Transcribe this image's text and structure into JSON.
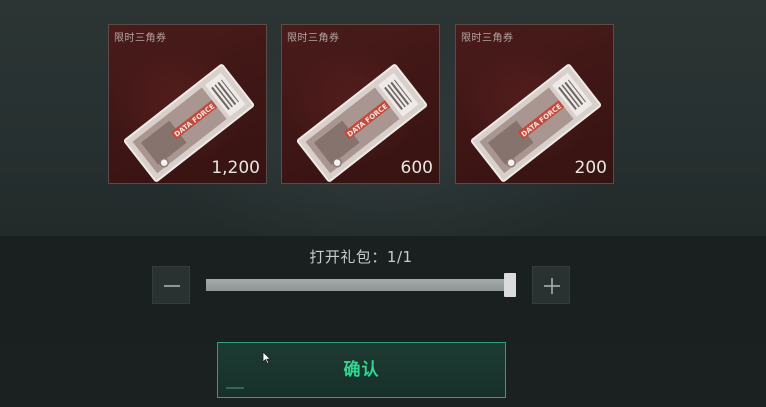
{
  "rewards": [
    {
      "tag": "限时三角券",
      "quantity": "1,200",
      "ticket_text": "DATA FORCE"
    },
    {
      "tag": "限时三角券",
      "quantity": "600",
      "ticket_text": "DATA FORCE"
    },
    {
      "tag": "限时三角券",
      "quantity": "200",
      "ticket_text": "DATA FORCE"
    }
  ],
  "stepper": {
    "label": "打开礼包：1/1",
    "current": 1,
    "max": 1,
    "fill_fraction": 1.0,
    "minus_icon": "minus-icon",
    "plus_icon": "plus-icon"
  },
  "confirm": {
    "label": "确认"
  },
  "colors": {
    "accent": "#34d48f",
    "card_bg": "#451a19",
    "slider_fill": "#9ca2a2"
  }
}
